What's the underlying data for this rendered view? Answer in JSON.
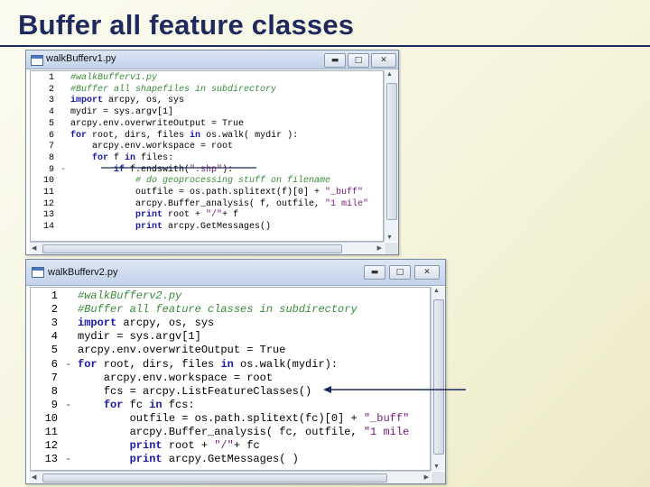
{
  "slide": {
    "title": "Buffer all feature classes"
  },
  "window1": {
    "title": "walkBufferv1.py",
    "controls": {
      "minimize": "▬",
      "maximize": "□",
      "close": "✕"
    },
    "lines": [
      {
        "num": "1",
        "fold": "",
        "tokens": [
          {
            "t": "#walkBufferv1.py",
            "c": "comment"
          }
        ]
      },
      {
        "num": "2",
        "fold": "",
        "tokens": [
          {
            "t": "#Buffer all shapefiles in subdirectory",
            "c": "comment"
          }
        ]
      },
      {
        "num": "3",
        "fold": "",
        "tokens": [
          {
            "t": "import",
            "c": "keyword"
          },
          {
            "t": " arcpy, os, sys",
            "c": ""
          }
        ]
      },
      {
        "num": "4",
        "fold": "",
        "tokens": [
          {
            "t": "mydir = sys.argv[1]",
            "c": ""
          }
        ]
      },
      {
        "num": "5",
        "fold": "",
        "tokens": [
          {
            "t": "arcpy.env.overwriteOutput = True",
            "c": ""
          }
        ]
      },
      {
        "num": "6",
        "fold": "",
        "tokens": [
          {
            "t": "for",
            "c": "keyword"
          },
          {
            "t": " root, dirs, files ",
            "c": ""
          },
          {
            "t": "in",
            "c": "keyword"
          },
          {
            "t": " os.walk( mydir ):",
            "c": ""
          }
        ]
      },
      {
        "num": "7",
        "fold": "",
        "tokens": [
          {
            "t": "    arcpy.env.workspace = root",
            "c": ""
          }
        ]
      },
      {
        "num": "8",
        "fold": "",
        "tokens": [
          {
            "t": "    ",
            "c": ""
          },
          {
            "t": "for",
            "c": "keyword"
          },
          {
            "t": " f ",
            "c": ""
          },
          {
            "t": "in",
            "c": "keyword"
          },
          {
            "t": " files:",
            "c": ""
          }
        ]
      },
      {
        "num": "9",
        "fold": "-",
        "tokens": [
          {
            "t": "        ",
            "c": ""
          },
          {
            "t": "if",
            "c": "keyword"
          },
          {
            "t": " f.endswith(",
            "c": ""
          },
          {
            "t": "\".shp\"",
            "c": "string"
          },
          {
            "t": "):",
            "c": ""
          }
        ]
      },
      {
        "num": "10",
        "fold": "",
        "tokens": [
          {
            "t": "            ",
            "c": ""
          },
          {
            "t": "# do geoprocessing stuff on filename",
            "c": "comment"
          }
        ]
      },
      {
        "num": "11",
        "fold": "",
        "tokens": [
          {
            "t": "            outfile = os.path.splitext(f)[0] + ",
            "c": ""
          },
          {
            "t": "\"_buff\"",
            "c": "string"
          }
        ]
      },
      {
        "num": "12",
        "fold": "",
        "tokens": [
          {
            "t": "            arcpy.Buffer_analysis( f, outfile, ",
            "c": ""
          },
          {
            "t": "\"1 mile\"",
            "c": "string"
          }
        ]
      },
      {
        "num": "13",
        "fold": "",
        "tokens": [
          {
            "t": "            ",
            "c": ""
          },
          {
            "t": "print",
            "c": "keyword"
          },
          {
            "t": " root + ",
            "c": ""
          },
          {
            "t": "\"/\"",
            "c": "string"
          },
          {
            "t": "+ f",
            "c": ""
          }
        ]
      },
      {
        "num": "14",
        "fold": "",
        "tokens": [
          {
            "t": "            ",
            "c": ""
          },
          {
            "t": "print",
            "c": "keyword"
          },
          {
            "t": " arcpy.GetMessages()",
            "c": ""
          }
        ]
      }
    ]
  },
  "window2": {
    "title": "walkBufferv2.py",
    "controls": {
      "minimize": "▬",
      "maximize": "□",
      "close": "✕"
    },
    "lines": [
      {
        "num": "1",
        "fold": "",
        "tokens": [
          {
            "t": "#walkBufferv2.py",
            "c": "comment"
          }
        ]
      },
      {
        "num": "2",
        "fold": "",
        "tokens": [
          {
            "t": "#Buffer all feature classes in subdirectory",
            "c": "comment"
          }
        ]
      },
      {
        "num": "3",
        "fold": "",
        "tokens": [
          {
            "t": "import",
            "c": "keyword"
          },
          {
            "t": " arcpy, os, sys",
            "c": ""
          }
        ]
      },
      {
        "num": "4",
        "fold": "",
        "tokens": [
          {
            "t": "mydir = sys.argv[1]",
            "c": ""
          }
        ]
      },
      {
        "num": "5",
        "fold": "",
        "tokens": [
          {
            "t": "arcpy.env.overwriteOutput = True",
            "c": ""
          }
        ]
      },
      {
        "num": "6",
        "fold": "-",
        "tokens": [
          {
            "t": "for",
            "c": "keyword"
          },
          {
            "t": " root, dirs, files ",
            "c": ""
          },
          {
            "t": "in",
            "c": "keyword"
          },
          {
            "t": " os.walk(mydir):",
            "c": ""
          }
        ]
      },
      {
        "num": "7",
        "fold": "",
        "tokens": [
          {
            "t": "    arcpy.env.workspace = root",
            "c": ""
          }
        ]
      },
      {
        "num": "8",
        "fold": "",
        "tokens": [
          {
            "t": "    fcs = arcpy.ListFeatureClasses()",
            "c": ""
          }
        ]
      },
      {
        "num": "9",
        "fold": "-",
        "tokens": [
          {
            "t": "    ",
            "c": ""
          },
          {
            "t": "for",
            "c": "keyword"
          },
          {
            "t": " fc ",
            "c": ""
          },
          {
            "t": "in",
            "c": "keyword"
          },
          {
            "t": " fcs:",
            "c": ""
          }
        ]
      },
      {
        "num": "10",
        "fold": "",
        "tokens": [
          {
            "t": "        outfile = os.path.splitext(fc)[0] + ",
            "c": ""
          },
          {
            "t": "\"_buff\"",
            "c": "string"
          }
        ]
      },
      {
        "num": "11",
        "fold": "",
        "tokens": [
          {
            "t": "        arcpy.Buffer_analysis( fc, outfile, ",
            "c": ""
          },
          {
            "t": "\"1 mile",
            "c": "string"
          }
        ]
      },
      {
        "num": "12",
        "fold": "",
        "tokens": [
          {
            "t": "        ",
            "c": ""
          },
          {
            "t": "print",
            "c": "keyword"
          },
          {
            "t": " root + ",
            "c": ""
          },
          {
            "t": "\"/\"",
            "c": "string"
          },
          {
            "t": "+ fc",
            "c": ""
          }
        ]
      },
      {
        "num": "13",
        "fold": "-",
        "tokens": [
          {
            "t": "        ",
            "c": ""
          },
          {
            "t": "print",
            "c": "keyword"
          },
          {
            "t": " arcpy.GetMessages( )",
            "c": ""
          }
        ]
      }
    ]
  }
}
